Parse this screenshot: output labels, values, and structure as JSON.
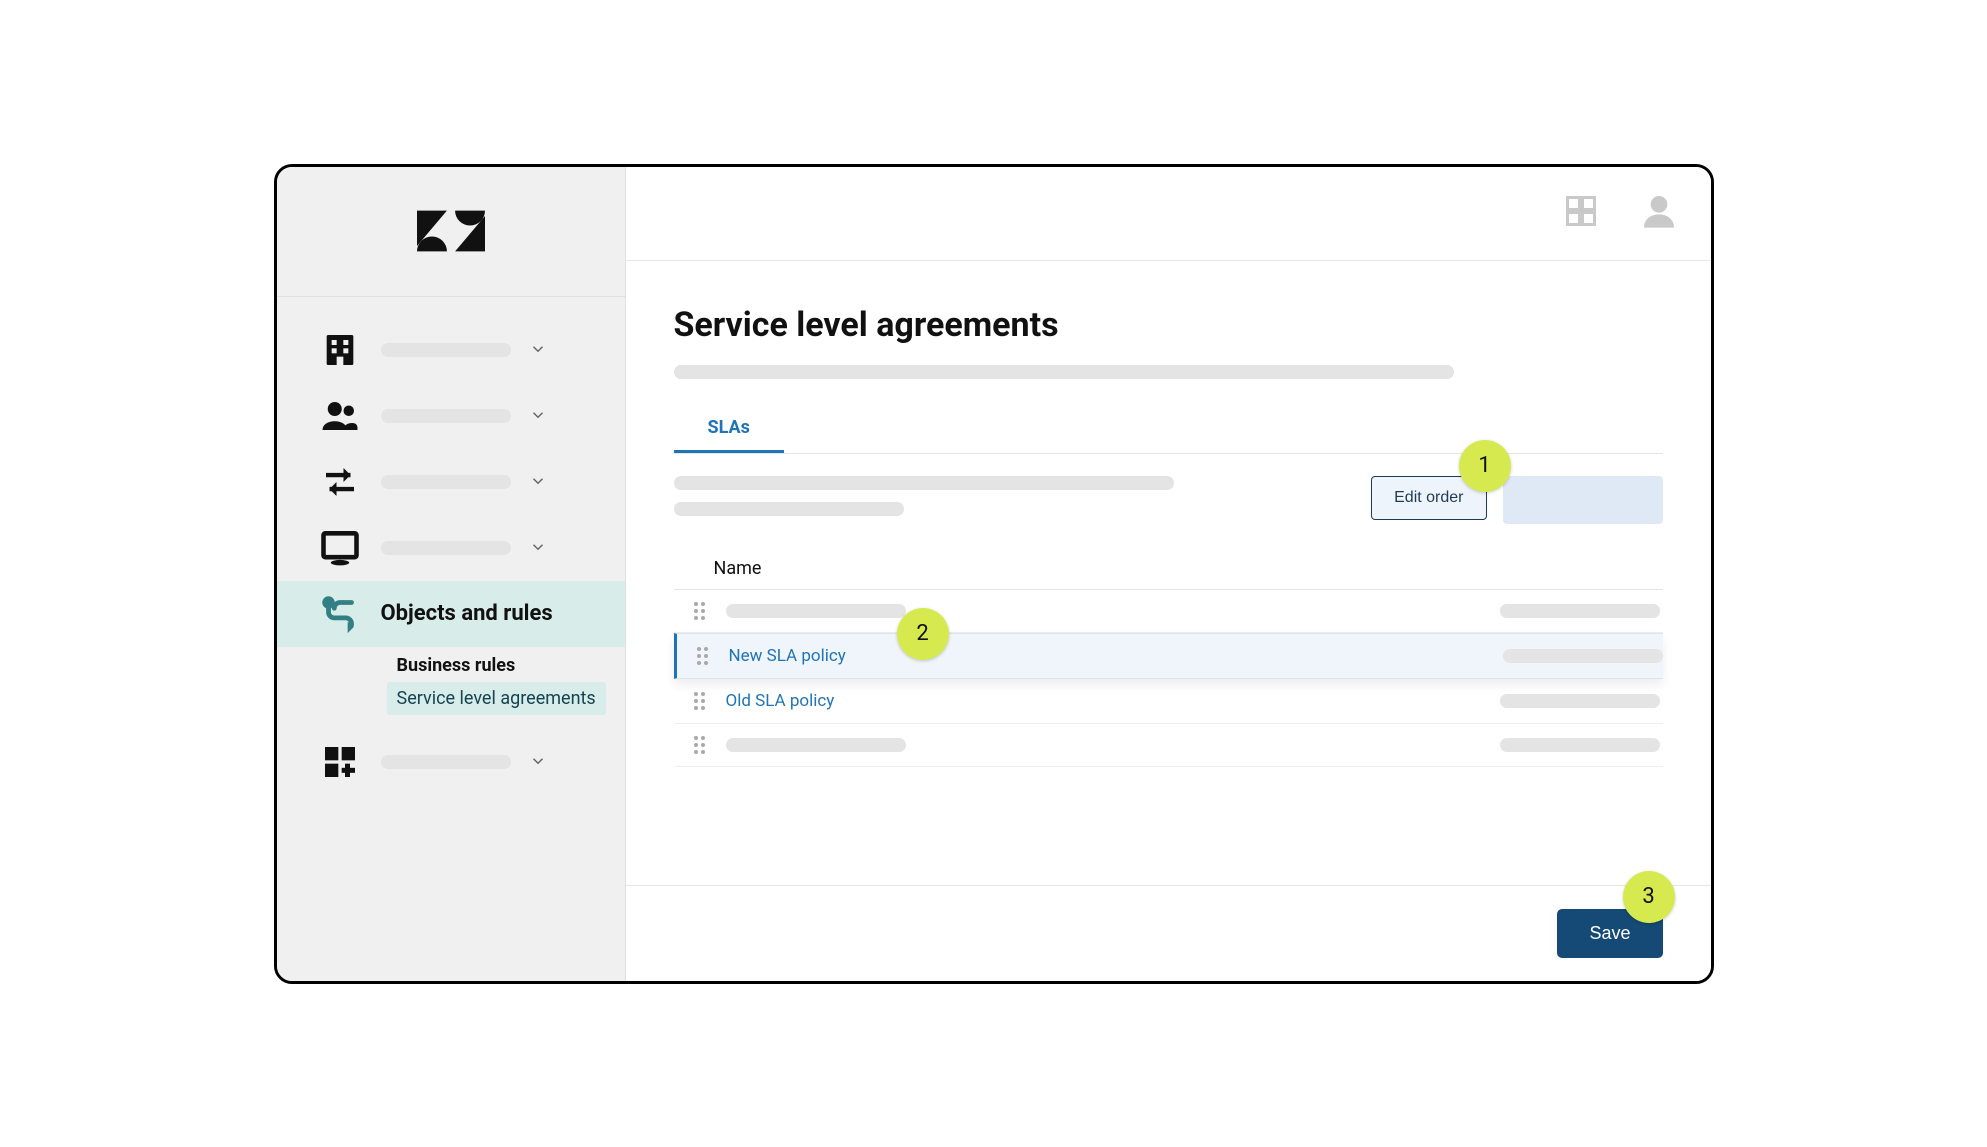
{
  "sidebar": {
    "active_label": "Objects and rules",
    "sub": {
      "business_rules": "Business rules",
      "sla": "Service level agreements"
    }
  },
  "page": {
    "title": "Service level agreements"
  },
  "tabs": {
    "slas": "SLAs"
  },
  "toolbar": {
    "edit_order": "Edit order"
  },
  "table": {
    "columns": {
      "name": "Name"
    },
    "rows": [
      {
        "name_placeholder": true
      },
      {
        "name": "New SLA policy",
        "active": true
      },
      {
        "name": "Old SLA policy"
      },
      {
        "name_placeholder": true
      }
    ]
  },
  "footer": {
    "save": "Save"
  },
  "callouts": {
    "one": "1",
    "two": "2",
    "three": "3"
  }
}
